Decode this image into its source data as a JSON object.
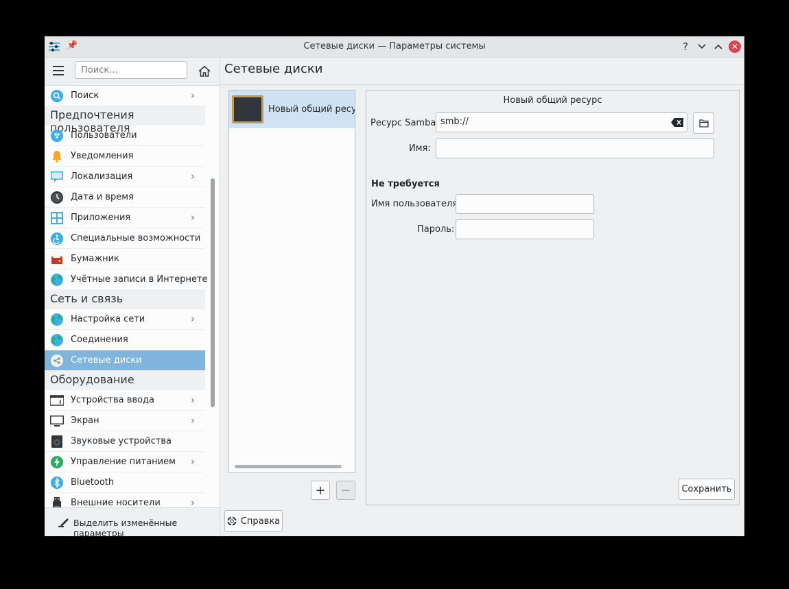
{
  "window": {
    "title": "Сетевые диски — Параметры системы"
  },
  "titlebar": {
    "help": "?",
    "minimize": "⌄",
    "maximize": "⌃",
    "close": "✕"
  },
  "sidebar": {
    "search_placeholder": "Поиск...",
    "items": [
      {
        "label": "Поиск",
        "icon": "search-icon",
        "chevron": true
      },
      {
        "category": "Предпочтения пользователя"
      },
      {
        "label": "Пользователи",
        "icon": "users-icon",
        "chevron": false
      },
      {
        "label": "Уведомления",
        "icon": "bell-icon",
        "chevron": false
      },
      {
        "label": "Локализация",
        "icon": "localization-icon",
        "chevron": true
      },
      {
        "label": "Дата и время",
        "icon": "clock-icon",
        "chevron": false
      },
      {
        "label": "Приложения",
        "icon": "applications-icon",
        "chevron": true
      },
      {
        "label": "Специальные возможности",
        "icon": "accessibility-icon",
        "chevron": false
      },
      {
        "label": "Бумажник",
        "icon": "wallet-icon",
        "chevron": false
      },
      {
        "label": "Учётные записи в Интернете",
        "icon": "online-accounts-icon",
        "chevron": false
      },
      {
        "category": "Сеть и связь"
      },
      {
        "label": "Настройка сети",
        "icon": "network-globe-icon",
        "chevron": true
      },
      {
        "label": "Соединения",
        "icon": "connections-globe-icon",
        "chevron": false
      },
      {
        "label": "Сетевые диски",
        "icon": "share-icon",
        "chevron": false,
        "active": true
      },
      {
        "category": "Оборудование"
      },
      {
        "label": "Устройства ввода",
        "icon": "keyboard-icon",
        "chevron": true
      },
      {
        "label": "Экран",
        "icon": "monitor-icon",
        "chevron": true
      },
      {
        "label": "Звуковые устройства",
        "icon": "speaker-icon",
        "chevron": false
      },
      {
        "label": "Управление питанием",
        "icon": "power-icon",
        "chevron": true
      },
      {
        "label": "Bluetooth",
        "icon": "bluetooth-icon",
        "chevron": false
      },
      {
        "label": "Внешние носители",
        "icon": "usb-icon",
        "chevron": true
      }
    ],
    "footer_label": "Выделить изменённые параметры"
  },
  "main": {
    "title": "Сетевые диски",
    "share_item_label": "Новый общий ресурс",
    "add_label": "+",
    "remove_label": "−",
    "help_label": "Справка"
  },
  "form": {
    "title": "Новый общий ресурс",
    "samba_label": "Ресурс Samba:",
    "samba_value": "smb://",
    "name_label": "Имя:",
    "name_value": "",
    "auth_label": "Не требуется",
    "username_label": "Имя пользователя:",
    "password_label": "Пароль:",
    "save_label": "Сохранить"
  },
  "colors": {
    "accent": "#7fb4dc",
    "close": "#da4453",
    "selection": "#cfe3f3"
  }
}
